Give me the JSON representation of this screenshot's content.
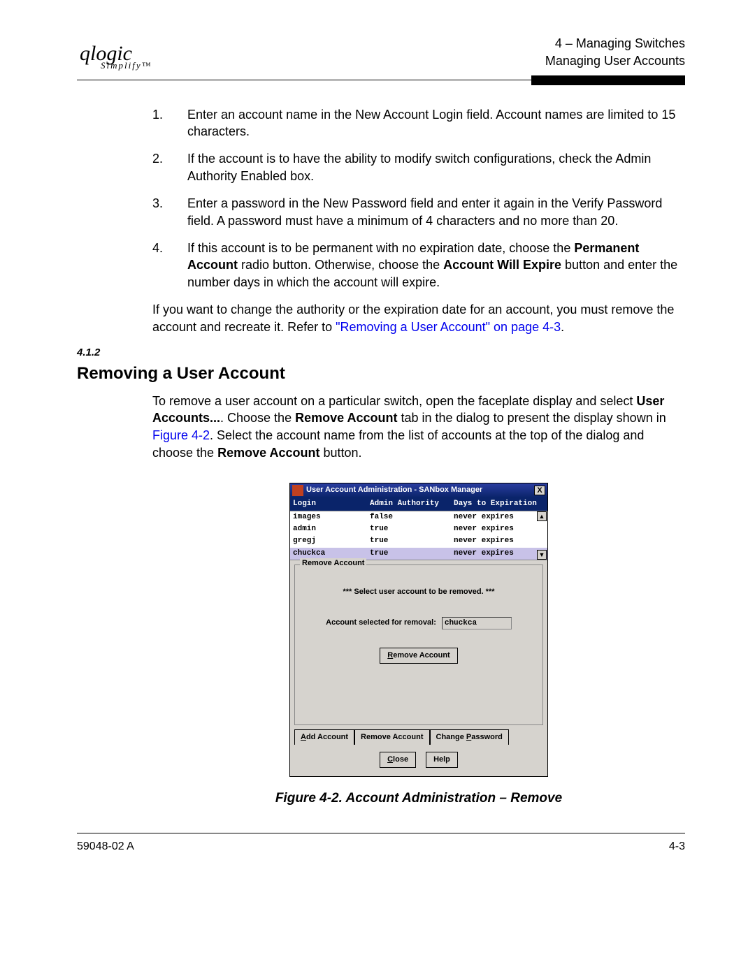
{
  "header": {
    "logo_main": "qlogic",
    "logo_sub": "Simplify™",
    "right_line1": "4 – Managing Switches",
    "right_line2": "Managing User Accounts"
  },
  "steps": [
    {
      "n": "1.",
      "text_a": "Enter an account name in the New Account Login field. Account names are limited to 15 characters."
    },
    {
      "n": "2.",
      "text_a": "If the account is to have the ability to modify switch configurations, check the Admin Authority Enabled box."
    },
    {
      "n": "3.",
      "text_a": "Enter a password in the New Password field and enter it again in the Verify Password field. A password must have a minimum of 4 characters and no more than 20."
    },
    {
      "n": "4.",
      "text_a": "If this account is to be permanent with no expiration date, choose the ",
      "b1": "Permanent Account",
      "mid": " radio button. Otherwise, choose the ",
      "b2": "Account Will Expire",
      "tail": " button and enter the number days in which the account will expire."
    }
  ],
  "para_change_a": "If you want to change the authority or the expiration date for an account, you must remove the account and recreate it. Refer to ",
  "para_change_link": "\"Removing a User Account\" on page 4-3",
  "para_change_b": ".",
  "section_num": "4.1.2",
  "section_title": "Removing a User Account",
  "section_para_a": "To remove a user account on a particular switch, open the faceplate display and select ",
  "section_para_b1": "User Accounts...",
  "section_para_c": ". Choose the ",
  "section_para_b2": "Remove Account",
  "section_para_d": " tab in the dialog to present the display shown in ",
  "section_para_link": "Figure 4-2",
  "section_para_e": ". Select the account name from the list of accounts at the top of the dialog and choose the ",
  "section_para_b3": "Remove Account",
  "section_para_f": " button.",
  "dialog": {
    "title": "User Account Administration - SANbox Manager",
    "cols": {
      "c1": "Login",
      "c2": "Admin Authority",
      "c3": "Days to Expiration"
    },
    "rows": [
      {
        "login": "images",
        "admin": "false",
        "exp": "never expires",
        "sel": false
      },
      {
        "login": "admin",
        "admin": "true",
        "exp": "never expires",
        "sel": false
      },
      {
        "login": "gregj",
        "admin": "true",
        "exp": "never expires",
        "sel": false
      },
      {
        "login": "chuckca",
        "admin": "true",
        "exp": "never expires",
        "sel": true
      }
    ],
    "panel_label": "Remove Account",
    "prompt": "*** Select user account to be removed. ***",
    "sel_label": "Account selected for removal:",
    "sel_value": "chuckca",
    "remove_btn": "Remove Account",
    "tabs": {
      "t1": "Add Account",
      "t2": "Remove Account",
      "t3": "Change Password"
    },
    "close_btn": "Close",
    "help_btn": "Help",
    "x": "X",
    "up": "▲",
    "down": "▼"
  },
  "caption": "Figure 4-2.  Account Administration – Remove",
  "footer": {
    "left": "59048-02  A",
    "right": "4-3"
  }
}
